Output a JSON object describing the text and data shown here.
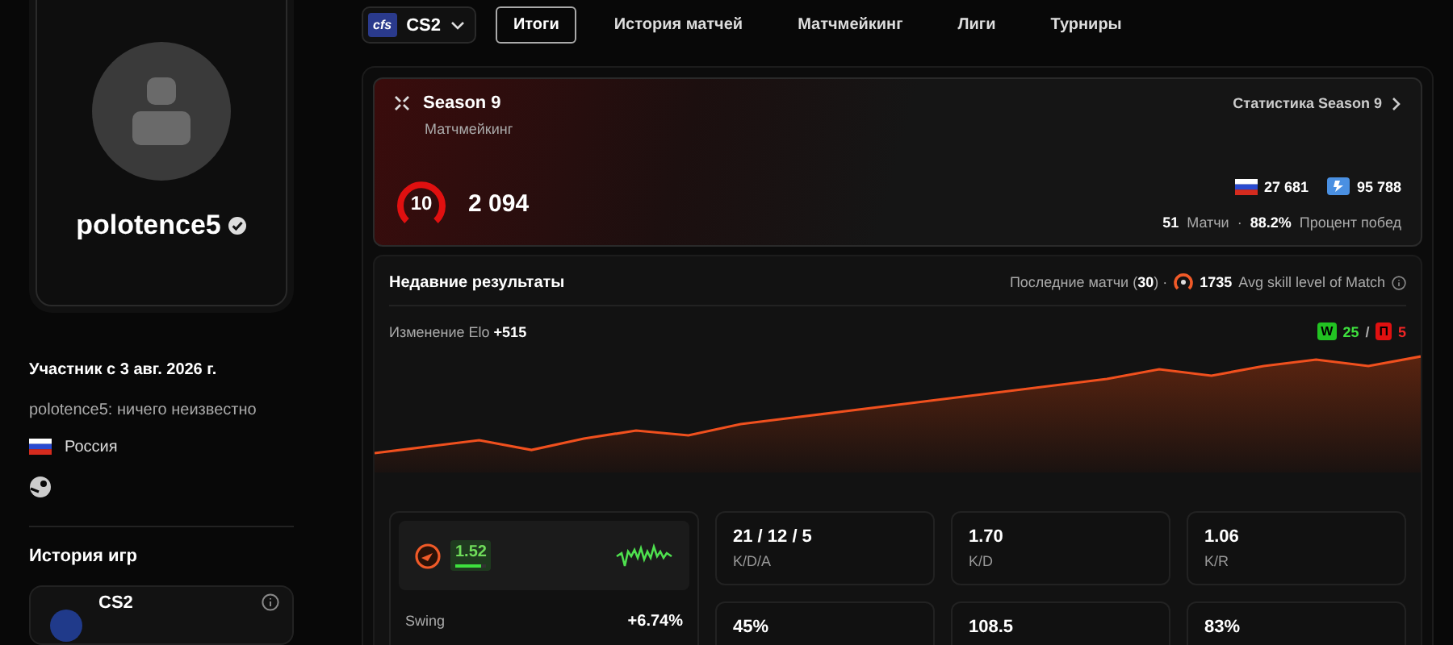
{
  "game_selector": {
    "logo": "cfs",
    "label": "CS2"
  },
  "tabs": [
    {
      "label": "Итоги",
      "selected": true
    },
    {
      "label": "История матчей",
      "selected": false
    },
    {
      "label": "Матчмейкинг",
      "selected": false
    },
    {
      "label": "Лиги",
      "selected": false
    },
    {
      "label": "Турниры",
      "selected": false
    }
  ],
  "profile": {
    "username": "polotence5",
    "verified": true,
    "member_since": "Участник с 3 авг. 2026 г.",
    "bio": "polotence5: ничего неизвестно",
    "country": "Россия"
  },
  "game_history": {
    "title": "История игр",
    "items": [
      {
        "name": "CS2"
      }
    ]
  },
  "season": {
    "title": "Season 9",
    "subtitle": "Матчмейкинг",
    "link": "Статистика Season 9",
    "level": "10",
    "elo": "2 094",
    "country_rank": "27 681",
    "region_rank": "95 788",
    "matches": "51",
    "matches_label": "Матчи",
    "separator": "·",
    "winrate": "88.2%",
    "winrate_label": "Процент побед"
  },
  "recent": {
    "title": "Недавние результаты",
    "last_matches": "Последние матчи (**30**) ·",
    "avg_skill": "1735",
    "avg_skill_label": "Avg skill level of Match",
    "elo_change_label": "Изменение Elo",
    "elo_change": "+515",
    "wins_badge": "W",
    "wins": "25",
    "separator": "/",
    "losses_badge": "П",
    "losses": "5"
  },
  "rating": {
    "value": "1.52",
    "level": 0.8,
    "swing_label": "Swing",
    "swing": "+6.74%"
  },
  "stats": [
    {
      "value": "21 / 12 / 5",
      "label": "K/D/A"
    },
    {
      "value": "1.70",
      "label": "K/D"
    },
    {
      "value": "1.06",
      "label": "K/R"
    },
    {
      "value": "45%"
    },
    {
      "value": "108.5"
    },
    {
      "value": "83%"
    }
  ]
}
